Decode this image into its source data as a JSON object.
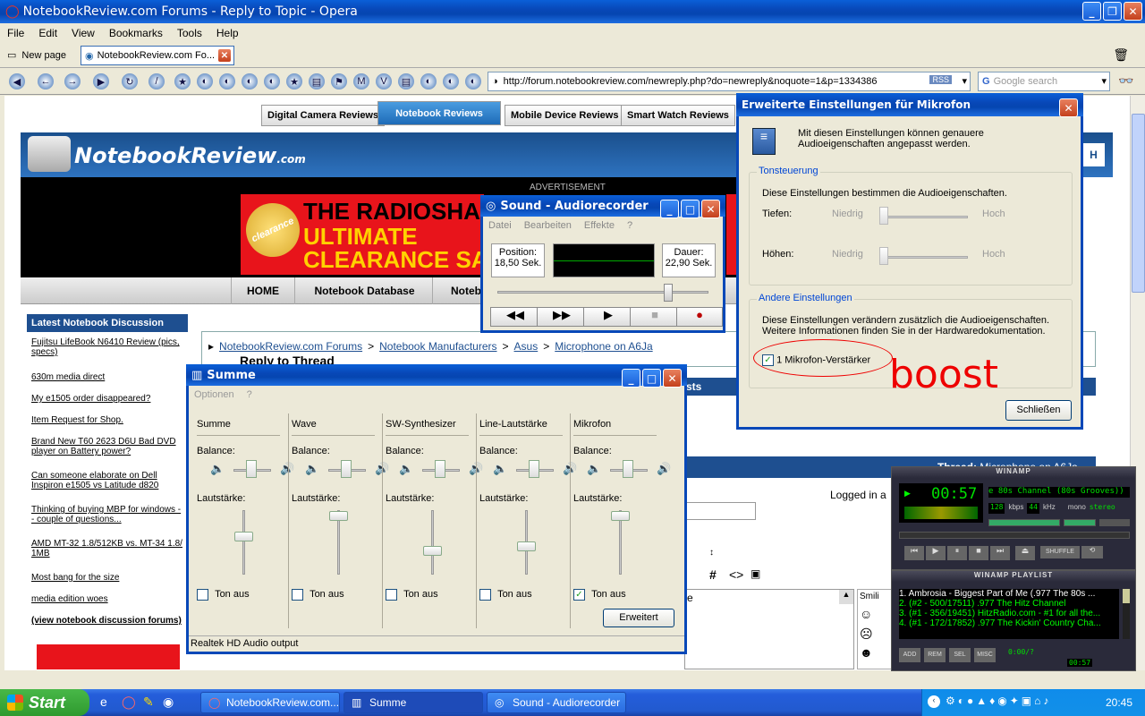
{
  "opera": {
    "title": "NotebookReview.com Forums - Reply to Topic - Opera",
    "menu": [
      "File",
      "Edit",
      "View",
      "Bookmarks",
      "Tools",
      "Help"
    ],
    "tabs": [
      "New page",
      "NotebookReview.com Fo..."
    ],
    "url": "http://forum.notebookreview.com/newreply.php?do=newreply&noquote=1&p=1334386",
    "rss": "RSS",
    "search_placeholder": "Google search"
  },
  "site": {
    "tabs": [
      "Digital Camera Reviews",
      "Notebook Reviews",
      "Mobile Device Reviews",
      "Smart Watch Reviews"
    ],
    "logo": "NotebookReview",
    "logo_suffix": ".com",
    "ad_label": "ADVERTISEMENT",
    "ad_line1": "THE RADIOSHA",
    "ad_line2": "ULTIMATE",
    "ad_line3": "CLEARANCE SA",
    "ad_badge": "clearance",
    "nav": [
      "HOME",
      "Notebook Database",
      "Notebo"
    ],
    "sidebar_title": "Latest Notebook Discussion",
    "sidebar_links": [
      "Fujitsu LifeBook N6410 Review (pics, specs)",
      "630m media direct",
      "My e1505 order disappeared?",
      "Item Request for Shop.",
      "Brand New T60 2623 D6U Bad DVD player on Battery power?",
      "Can someone elaborate on Dell Inspiron e1505 vs Latitude d820",
      "Thinking of buying MBP for windows -- couple of questions...",
      "AMD MT-32 1.8/512KB vs. MT-34 1.8/ 1MB",
      "Most bang for the size",
      "media edition woes",
      "(view notebook discussion forums)"
    ],
    "breadcrumb": [
      "NotebookReview.com Forums",
      "Notebook Manufacturers",
      "Asus",
      "Microphone on A6Ja"
    ],
    "breadcrumb_sep": ">",
    "reply_title": "Reply to Thread",
    "thread_label": "Thread:",
    "thread_name": "Microphone on A6Ja",
    "logged_in": "Logged in a",
    "sts": "sts",
    "smilies": "Smili",
    "editor_e": "e"
  },
  "recorder": {
    "title": "Sound - Audiorecorder",
    "menu": [
      "Datei",
      "Bearbeiten",
      "Effekte",
      "?"
    ],
    "position_label": "Position:",
    "position_value": "18,50 Sek.",
    "length_label": "Dauer:",
    "length_value": "22,90 Sek.",
    "position_fraction": 0.81
  },
  "mixer": {
    "title": "Summe",
    "menu": [
      "Optionen",
      "?"
    ],
    "balance_label": "Balance:",
    "volume_label": "Lautstärke:",
    "mute_label": "Ton aus",
    "channels": [
      {
        "name": "Summe",
        "volume": 0.6,
        "muted": false
      },
      {
        "name": "Wave",
        "volume": 0.92,
        "muted": false
      },
      {
        "name": "SW-Synthesizer",
        "volume": 0.38,
        "muted": false
      },
      {
        "name": "Line-Lautstärke",
        "volume": 0.45,
        "muted": false
      },
      {
        "name": "Mikrofon",
        "volume": 0.92,
        "muted": true
      }
    ],
    "advanced_button": "Erweitert",
    "status": "Realtek HD Audio output"
  },
  "mic_dialog": {
    "title": "Erweiterte Einstellungen für Mikrofon",
    "intro": "Mit diesen Einstellungen können genauere Audioeigenschaften angepasst werden.",
    "tone_group": "Tonsteuerung",
    "tone_desc": "Diese Einstellungen bestimmen die Audioeigenschaften.",
    "bass_label": "Tiefen:",
    "treble_label": "Höhen:",
    "low": "Niedrig",
    "high": "Hoch",
    "other_group": "Andere Einstellungen",
    "other_desc": "Diese Einstellungen verändern zusätzlich die Audioeigenschaften. Weitere Informationen finden Sie in der Hardwaredokumentation.",
    "boost_label": "1  Mikrofon-Verstärker",
    "boost_checked": true,
    "annotation": "boost",
    "close_button": "Schließen",
    "search_h": "H"
  },
  "winamp": {
    "title": "WINAMP",
    "time": "00:57",
    "song": "e 80s Channel (80s Grooves)) ***",
    "kbps": "128",
    "kbps_label": "kbps",
    "khz": "44",
    "khz_label": "kHz",
    "mono": "mono",
    "stereo": "stereo",
    "shuffle": "SHUFFLE",
    "playlist_title": "WINAMP PLAYLIST",
    "playlist": [
      "1. Ambrosia - Biggest Part of Me (.977 The 80s ...",
      "2. (#2 - 500/17511) .977 The Hitz Channel",
      "3. (#1 - 356/19451) HitzRadio.com - #1 for all the...",
      "4. (#1 - 172/17852) .977 The Kickin' Country Cha..."
    ],
    "pl_buttons": [
      "ADD",
      "REM",
      "SEL",
      "MISC"
    ],
    "pl_time": "0:00/?",
    "pl_time2": "00:57"
  },
  "taskbar": {
    "start": "Start",
    "tasks": [
      "NotebookReview.com...",
      "Summe",
      "Sound - Audiorecorder"
    ],
    "clock": "20:45"
  }
}
